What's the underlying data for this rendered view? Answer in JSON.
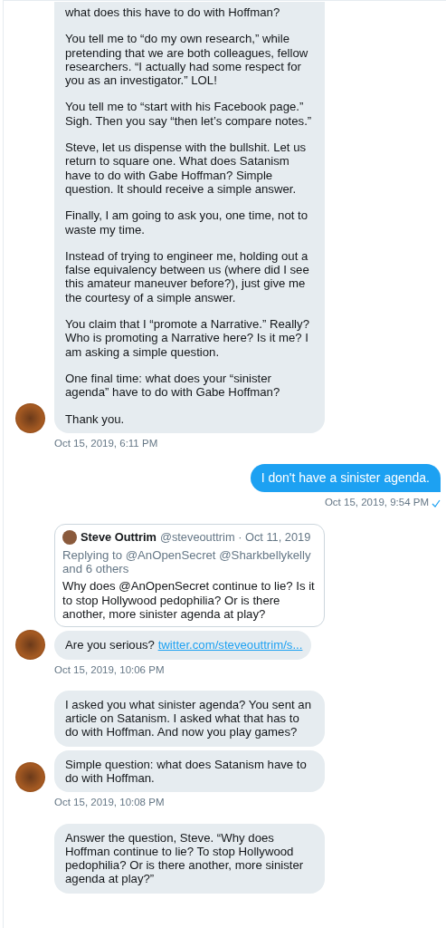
{
  "messages": [
    {
      "kind": "received",
      "avatar": true,
      "timestamp": "Oct 15, 2019, 6:11 PM",
      "read": false,
      "bubbles": [
        {
          "kind": "text",
          "paragraphs": [
            "what does this have to do with Hoffman?",
            "You tell me to “do my own research,” while pretending that we are both colleagues, fellow researchers. “I actually had some respect for you as an investigator.” LOL!",
            "You tell me to “start with his Facebook page.” Sigh. Then you say “then let’s compare notes.”",
            "Steve, let us dispense with the bullshit. Let us return to square one. What does Satanism have to do with Gabe Hoffman? Simple question. It should receive a simple answer.",
            "Finally, I am going to ask you, one time, not to waste my time.",
            "Instead of trying to engineer me, holding out a false equivalency between us (where did I see this amateur maneuver before?), just give me the courtesy of a simple answer.",
            "You claim that I “promote a Narrative.” Really? Who is promoting a Narrative here? Is it me? I am asking a simple question.",
            "One final time: what does your “sinister agenda” have to do with Gabe Hoffman?",
            "Thank you."
          ]
        }
      ]
    },
    {
      "kind": "sent",
      "timestamp": "Oct 15, 2019, 9:54 PM",
      "read": true,
      "bubbles": [
        {
          "kind": "text",
          "paragraphs": [
            "I don't have a sinister agenda."
          ]
        }
      ]
    },
    {
      "kind": "received",
      "avatar": true,
      "timestamp": "Oct 15, 2019, 10:06 PM",
      "read": false,
      "bubbles": [
        {
          "kind": "quote",
          "name": "Steve Outtrim",
          "handle": "@steveouttrim · Oct 11, 2019",
          "replying": "Replying to @AnOpenSecret @Sharkbellykelly and 6 others",
          "text": "Why does @AnOpenSecret continue to lie? Is it to stop Hollywood pedophilia? Or is there another, more sinister agenda at play?"
        },
        {
          "kind": "link",
          "text": "Are you serious?",
          "link": "twitter.com/steveouttrim/s..."
        }
      ]
    },
    {
      "kind": "received",
      "avatar": true,
      "timestamp": "Oct 15, 2019, 10:08 PM",
      "read": false,
      "bubbles": [
        {
          "kind": "text",
          "paragraphs": [
            "I asked you what sinister agenda? You sent an article on Satanism. I asked what that has to do with Hoffman. And now you play games?"
          ]
        },
        {
          "kind": "text",
          "paragraphs": [
            "Simple question: what does Satanism have to do with Hoffman."
          ]
        }
      ]
    },
    {
      "kind": "received",
      "avatar": false,
      "read": false,
      "bubbles": [
        {
          "kind": "text",
          "paragraphs": [
            "Answer the question, Steve. “Why does Hoffman continue to lie? To stop Hollywood pedophilia? Or is there another, more sinister agenda at play?”"
          ]
        }
      ]
    }
  ]
}
